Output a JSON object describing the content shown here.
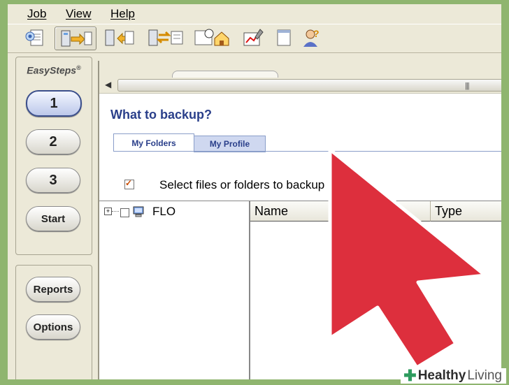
{
  "menu": [
    "Job",
    "View",
    "Help"
  ],
  "toolbar": {
    "icons": [
      "file-list-icon",
      "backup-icon",
      "restore-icon",
      "compare-icon",
      "schedule-icon",
      "network-icon",
      "report-icon",
      "blank-page-icon",
      "help-person-icon"
    ]
  },
  "sidebar": {
    "brand": "EasySteps",
    "brand_mark": "®",
    "steps": [
      "1",
      "2",
      "3",
      "Start"
    ],
    "selected_step": "1",
    "bottom": [
      "Reports",
      "Options"
    ]
  },
  "main": {
    "heading": "What to backup?",
    "tabs": [
      "My Folders",
      "My Profile"
    ],
    "active_tab": "My Folders",
    "checkbox_label": "Select files or folders to backup",
    "checkbox_checked": true
  },
  "tree": {
    "root": "FLO"
  },
  "list": {
    "columns": [
      "Name",
      "Type"
    ]
  },
  "overlay": {
    "arrow_color": "#dd2f3d",
    "outline_color": "#ffffff"
  },
  "watermark": {
    "brand": "Healthy",
    "brand2": "Living",
    "accent": "#2e9b5e"
  }
}
